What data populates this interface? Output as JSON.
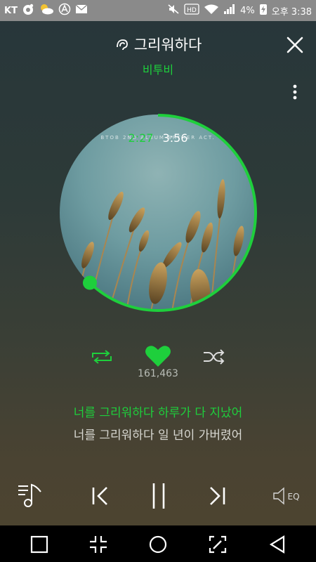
{
  "status_bar": {
    "carrier": "KT",
    "hd_label": "HD",
    "battery_percent": "4%",
    "time": "오후 3:38"
  },
  "header": {
    "song_title": "그리워하다",
    "artist": "비투비"
  },
  "album": {
    "caption": "BTOB 2ND ALBUM  BRTHER ACT.",
    "time_current": "2:27",
    "time_total": "3:56",
    "progress": 0.623
  },
  "actions": {
    "like_count": "161,463"
  },
  "lyrics": {
    "current": "너를 그리워하다 하루가 다 지났어",
    "next": "너를 그리워하다 일 년이 가버렸어"
  },
  "player": {
    "eq_label": "EQ"
  },
  "colors": {
    "accent": "#1ecf3c",
    "status_bar": "#8a8a8a"
  },
  "icons": [
    "sound-wave-icon",
    "close-icon",
    "more-icon",
    "repeat-icon",
    "heart-icon",
    "shuffle-icon",
    "playlist-icon",
    "previous-icon",
    "pause-icon",
    "next-icon",
    "equalizer-icon",
    "recent-apps-icon",
    "minimize-icon",
    "home-icon",
    "edit-icon",
    "back-icon"
  ]
}
